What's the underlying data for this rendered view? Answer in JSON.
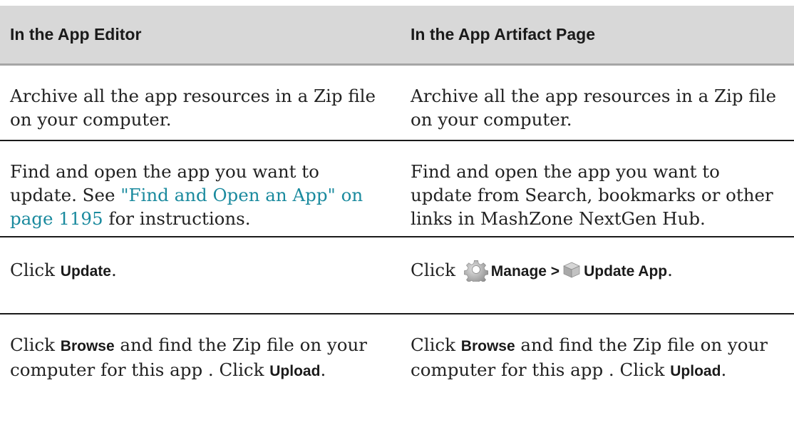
{
  "table": {
    "headers": [
      "In the App Editor",
      "In the App Artifact Page"
    ],
    "row1": {
      "editor": "Archive all the app resources in a Zip file on your computer.",
      "artifact": "Archive all the app resources in a Zip file on your computer."
    },
    "row2": {
      "editor_pre": "Find and open the app you want to update. See ",
      "editor_link": "\"Find and Open an App\" on page 1195",
      "editor_post": " for instructions.",
      "artifact": "Find and open the app you want to update from Search, bookmarks or other links in MashZone NextGen Hub."
    },
    "row3": {
      "editor_pre": "Click ",
      "editor_term": "Update",
      "editor_post": ".",
      "artifact_pre": "Click ",
      "artifact_icon1": "gear-icon",
      "artifact_term1": "Manage >",
      "artifact_icon2": "box-icon",
      "artifact_term2": "Update App",
      "artifact_post": "."
    },
    "row4": {
      "editor_pre": "Click ",
      "editor_term1": "Browse",
      "editor_mid": " and find the Zip file on your computer for this app . Click ",
      "editor_term2": "Upload",
      "editor_post": ".",
      "artifact_pre": "Click ",
      "artifact_term1": "Browse",
      "artifact_mid": " and find the Zip file on your computer for this app . Click ",
      "artifact_term2": "Upload",
      "artifact_post": "."
    }
  },
  "colors": {
    "header_bg": "#d8d8d8",
    "link": "#1a8a9e",
    "text": "#222222"
  }
}
